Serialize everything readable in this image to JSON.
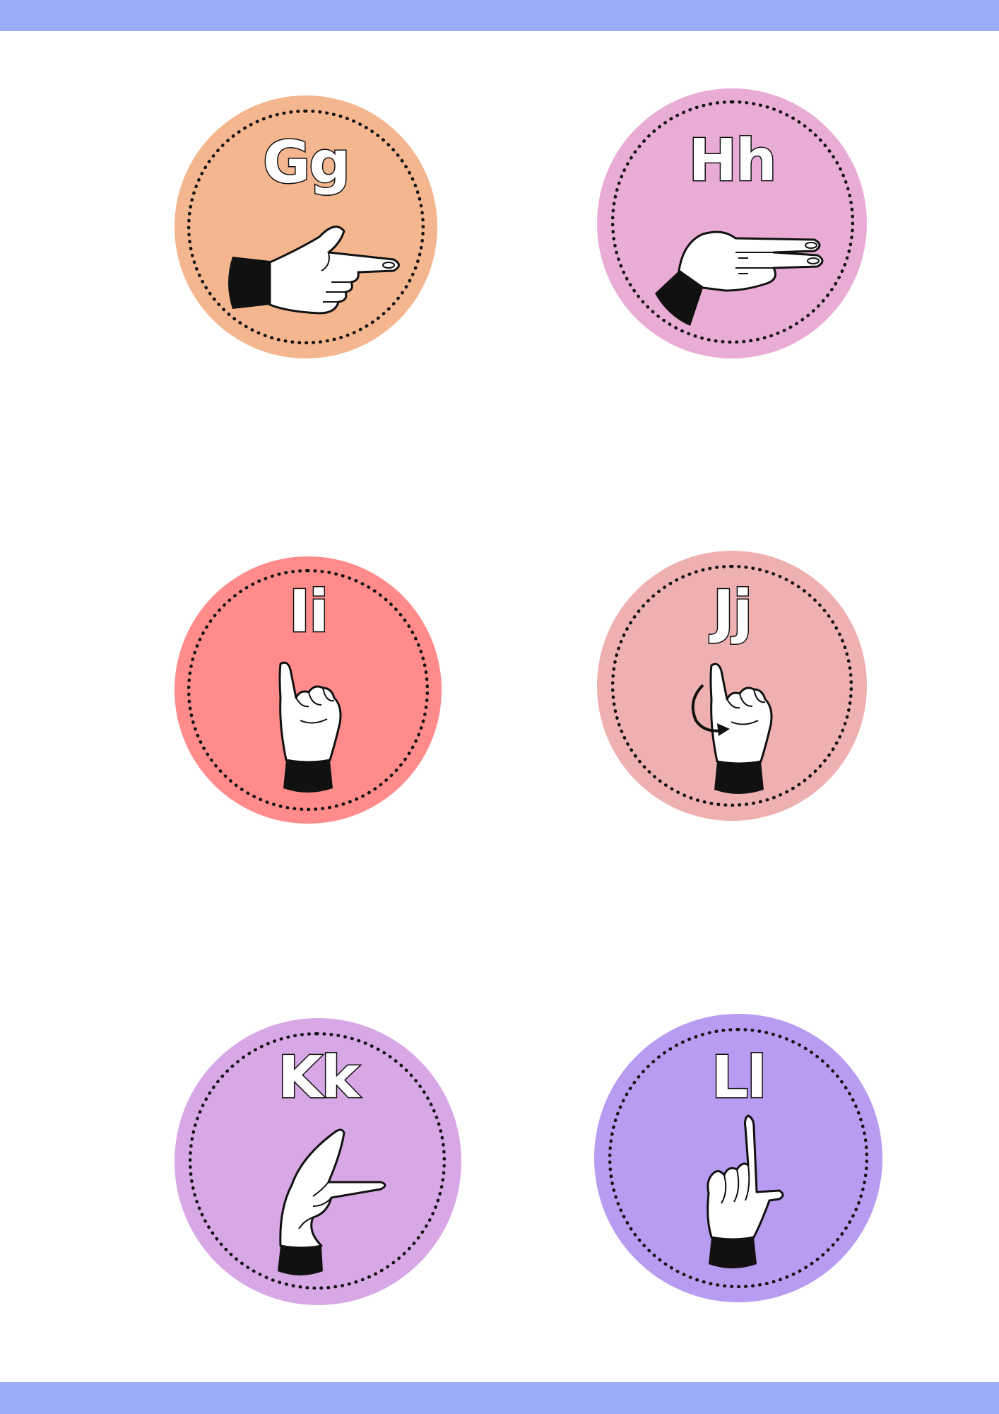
{
  "colors": {
    "band": "#9aabf7",
    "outline": "#111111"
  },
  "cards": [
    {
      "letter": "Gg",
      "color": "#f4b68f",
      "hand": "hand-pointing-sideways-icon"
    },
    {
      "letter": "Hh",
      "color": "#e9acd4",
      "hand": "hand-two-fingers-sideways-icon"
    },
    {
      "letter": "Ii",
      "color": "#ff8b8b",
      "hand": "hand-pinky-up-icon"
    },
    {
      "letter": "Jj",
      "color": "#eeb0b0",
      "hand": "hand-pinky-arc-icon"
    },
    {
      "letter": "Kk",
      "color": "#d8a8e6",
      "hand": "hand-index-middle-split-icon"
    },
    {
      "letter": "Ll",
      "color": "#b79cf1",
      "hand": "hand-l-shape-icon"
    }
  ]
}
